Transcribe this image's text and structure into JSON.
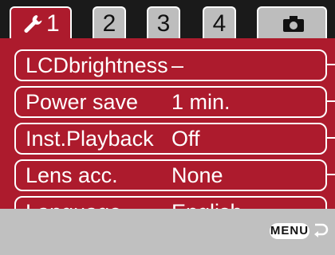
{
  "tabs": [
    {
      "label": "1",
      "icon": "wrench-icon",
      "active": true
    },
    {
      "label": "2",
      "active": false
    },
    {
      "label": "3",
      "active": false
    },
    {
      "label": "4",
      "active": false
    },
    {
      "label": "",
      "icon": "camera-icon",
      "active": false
    }
  ],
  "menu": {
    "items": [
      {
        "label": "LCDbrightness",
        "value": "–"
      },
      {
        "label": "Power save",
        "value": "1 min."
      },
      {
        "label": "Inst.Playback",
        "value": "Off"
      },
      {
        "label": "Lens acc.",
        "value": "None"
      },
      {
        "label": "Language",
        "value": "English"
      }
    ]
  },
  "footer": {
    "menu_label": "MENU",
    "return_icon": "return-arrow-icon"
  },
  "colors": {
    "accent": "#ad1b2d",
    "tab_inactive": "#bdbdbd",
    "footer": "#c0c0c0"
  }
}
